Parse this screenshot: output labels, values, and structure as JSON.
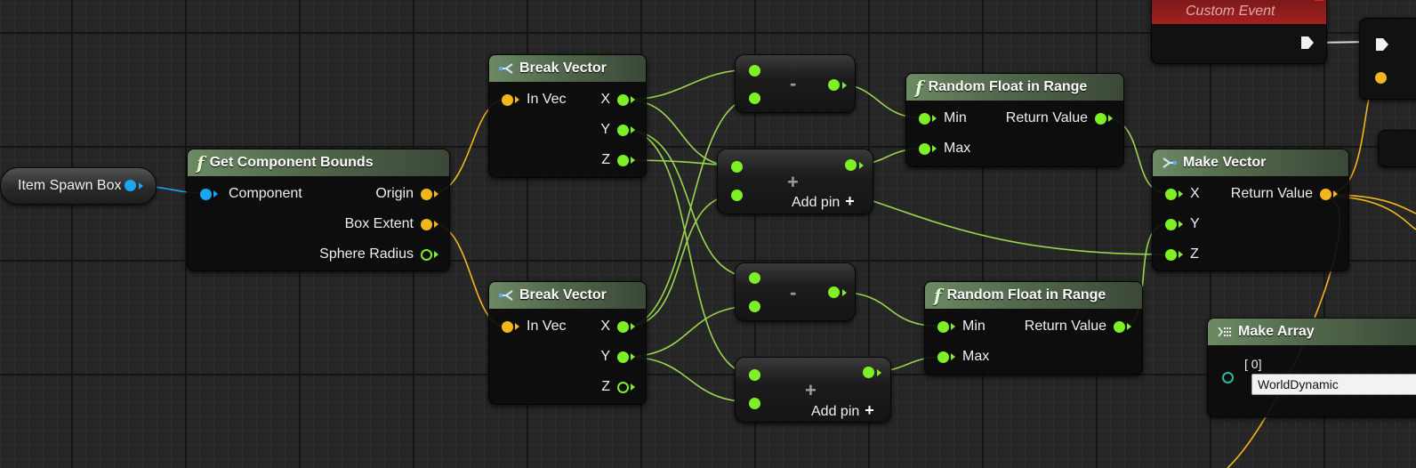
{
  "colors": {
    "float_pin": "#7ef026",
    "vector_pin": "#f3b71c",
    "object_pin": "#1aa6f2",
    "function_header": "#6c8a64",
    "event_header": "#a52020",
    "grid_background": "#262626"
  },
  "icons": {
    "function": "function-icon",
    "break_struct": "break-struct-icon",
    "make_struct": "make-struct-icon",
    "make_array": "make-array-icon",
    "add_pin": "plus-icon"
  },
  "var_node": {
    "label": "Item Spawn Box"
  },
  "get_bounds": {
    "title": "Get Component Bounds",
    "component": "Component",
    "origin": "Origin",
    "box_extent": "Box Extent",
    "sphere_radius": "Sphere Radius"
  },
  "break_top": {
    "title": "Break Vector",
    "in_vec": "In Vec",
    "x": "X",
    "y": "Y",
    "z": "Z"
  },
  "break_bottom": {
    "title": "Break Vector",
    "in_vec": "In Vec",
    "x": "X",
    "y": "Y",
    "z": "Z"
  },
  "minus_top": {
    "symbol": "-"
  },
  "plus_top": {
    "symbol": "+",
    "add_pin": "Add pin"
  },
  "minus_bottom": {
    "symbol": "-"
  },
  "plus_bottom": {
    "symbol": "+",
    "add_pin": "Add pin"
  },
  "random_top": {
    "title": "Random Float in Range",
    "min": "Min",
    "max": "Max",
    "ret": "Return Value"
  },
  "random_bottom": {
    "title": "Random Float in Range",
    "min": "Min",
    "max": "Max",
    "ret": "Return Value"
  },
  "make_vector": {
    "title": "Make Vector",
    "x": "X",
    "y": "Y",
    "z": "Z",
    "ret": "Return Value"
  },
  "event": {
    "label": "Custom Event"
  },
  "make_array": {
    "title": "Make Array",
    "index0": "[ 0]",
    "value0": "WorldDynamic"
  }
}
